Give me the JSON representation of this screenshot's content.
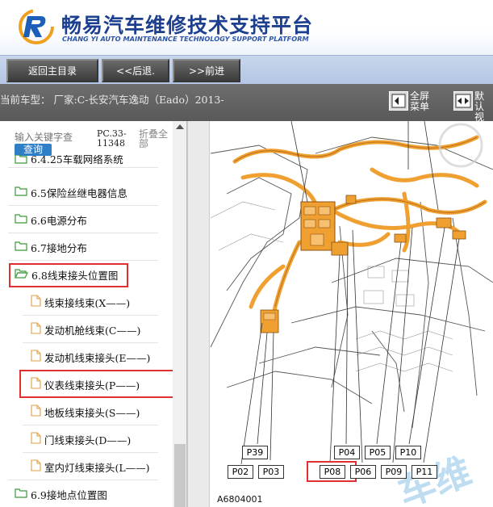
{
  "header": {
    "title": "畅易汽车维修技术支持平台",
    "subtitle": "CHANG YI AUTO MAINTENANCE TECHNOLOGY SUPPORT PLATFORM"
  },
  "nav": {
    "home": "返回主目录",
    "back": "<<后退.",
    "forward": ">>前进"
  },
  "vehicle_bar": {
    "current": "当前车型：  厂家:C-长安汽车逸动（Eado）2013-",
    "fullscreen_line1": "全屏",
    "fullscreen_line2": "菜单",
    "default_line1": "默认",
    "default_line2": "视图"
  },
  "sidebar": {
    "search_placeholder": "输入关键字查",
    "query_button": "查询",
    "pc_code": "PC.33-11348",
    "collapse_all": "折叠全部",
    "items": [
      {
        "label": "6.4.25车载网络系统",
        "type": "folder"
      },
      {
        "label": "6.5保险丝继电器信息",
        "type": "folder"
      },
      {
        "label": "6.6电源分布",
        "type": "folder"
      },
      {
        "label": "6.7接地分布",
        "type": "folder"
      },
      {
        "label": "6.8线束接头位置图",
        "type": "folder-open"
      },
      {
        "label": "线束接线束(X——)",
        "type": "doc"
      },
      {
        "label": "发动机舱线束(C——)",
        "type": "doc"
      },
      {
        "label": "发动机线束接头(E——)",
        "type": "doc"
      },
      {
        "label": "仪表线束接头(P——)",
        "type": "doc"
      },
      {
        "label": "地板线束接头(S——)",
        "type": "doc"
      },
      {
        "label": "门线束接头(D——)",
        "type": "doc"
      },
      {
        "label": "室内灯线束接头(L——)",
        "type": "doc"
      },
      {
        "label": "6.9接地点位置图",
        "type": "folder"
      }
    ]
  },
  "diagram": {
    "figure_id": "A6804001",
    "connectors": [
      "P39",
      "P02",
      "P03",
      "P08",
      "P04",
      "P06",
      "P05",
      "P09",
      "P10",
      "P11"
    ]
  },
  "colors": {
    "title_blue": "#1c3f8f",
    "highlight_red": "#e03030",
    "harness_orange": "#f0a030",
    "folder_green": "#3a9a3a"
  }
}
